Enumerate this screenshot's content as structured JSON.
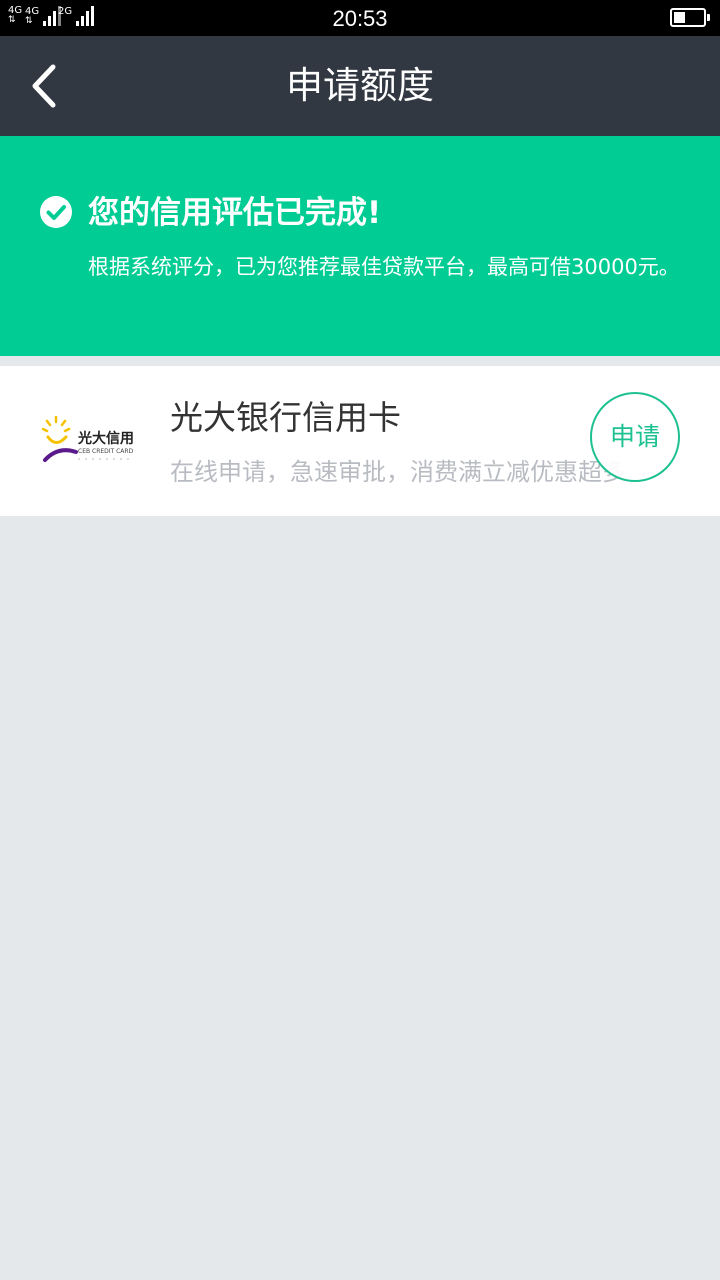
{
  "status_bar": {
    "time": "20:53",
    "net1": "4G",
    "net2": "4G",
    "net3": "2G",
    "battery_level": 0.4
  },
  "nav": {
    "title": "申请额度",
    "back_icon": "chevron-left-icon"
  },
  "banner": {
    "title": "您的信用评估已完成!",
    "description": "根据系统评分，已为您推荐最佳贷款平台，最高可借30000元。",
    "icon": "check-circle-icon",
    "color": "#00cc93"
  },
  "card": {
    "logo_text": "光大信用卡",
    "logo_subtext": "CEB CREDIT CARD",
    "title": "光大银行信用卡",
    "description": "在线申请，急速审批，消费满立减优惠超多",
    "apply_label": "申请",
    "accent": "#1dc191"
  }
}
